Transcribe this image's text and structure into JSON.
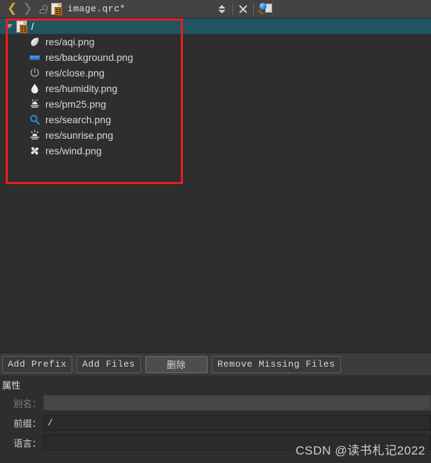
{
  "titlebar": {
    "back_icon": "chevron-left-icon",
    "forward_icon": "chevron-right-icon",
    "lock_icon": "unlocked-padlock-icon",
    "file_icon": "qrc-file-icon",
    "filename": "image.qrc*",
    "updown_icon": "split-selector-icon",
    "close_icon": "close-x-icon",
    "split_icon": "split-editor-icon"
  },
  "tree": {
    "root": {
      "label": "/",
      "icon": "qrc-prefix-icon",
      "expanded": true,
      "selected": true,
      "selection_color": "#1f555f"
    },
    "items": [
      {
        "label": "res/aqi.png",
        "icon": "leaf-icon"
      },
      {
        "label": "res/background.png",
        "icon": "image-rectangle-icon"
      },
      {
        "label": "res/close.png",
        "icon": "power-icon"
      },
      {
        "label": "res/humidity.png",
        "icon": "water-drop-icon"
      },
      {
        "label": "res/pm25.png",
        "icon": "haze-icon"
      },
      {
        "label": "res/search.png",
        "icon": "search-icon"
      },
      {
        "label": "res/sunrise.png",
        "icon": "sunrise-icon"
      },
      {
        "label": "res/wind.png",
        "icon": "wind-fan-icon"
      }
    ]
  },
  "annotation": {
    "color": "#ee1c23"
  },
  "buttons": [
    {
      "label": "Add Prefix",
      "state": "normal"
    },
    {
      "label": "Add Files",
      "state": "normal"
    },
    {
      "label": "删除",
      "state": "hover"
    },
    {
      "label": "Remove Missing Files",
      "state": "normal"
    }
  ],
  "properties": {
    "title": "属性",
    "fields": [
      {
        "label": "别名：",
        "value": "",
        "disabled": true
      },
      {
        "label": "前缀：",
        "value": "/",
        "disabled": false
      },
      {
        "label": "语言：",
        "value": "",
        "disabled": false
      }
    ]
  },
  "watermark": "CSDN @读书札记2022"
}
